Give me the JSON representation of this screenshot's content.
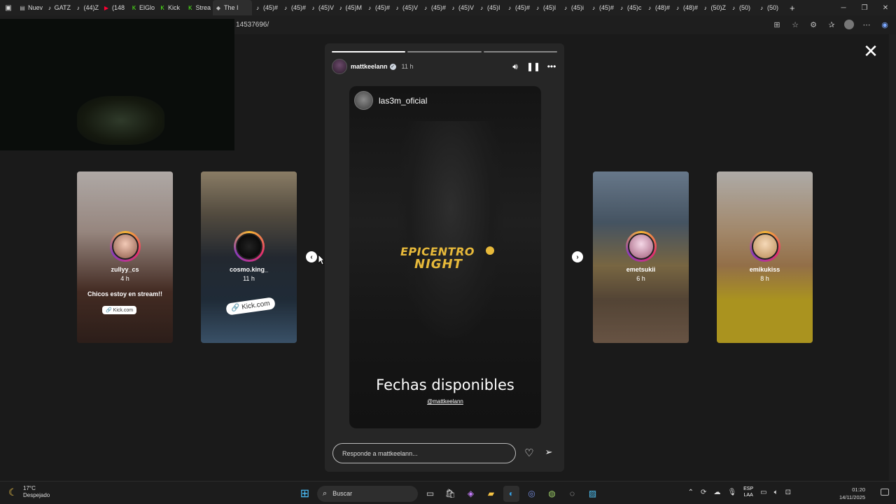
{
  "browser": {
    "tabs": [
      {
        "label": "Nuev",
        "icon": "document-icon",
        "color": "#bbbbbb"
      },
      {
        "label": "GATZ",
        "icon": "tiktok-icon",
        "color": "#ffffff"
      },
      {
        "label": "(44)Z",
        "icon": "tiktok-icon",
        "color": "#ffffff"
      },
      {
        "label": "(148",
        "icon": "youtube-icon",
        "color": "#ff0033"
      },
      {
        "label": "ElGlo",
        "icon": "kick-icon",
        "color": "#53fc18"
      },
      {
        "label": "Kick",
        "icon": "kick-icon",
        "color": "#53fc18"
      },
      {
        "label": "Strea",
        "icon": "kick-icon",
        "color": "#53fc18"
      },
      {
        "label": "The I",
        "icon": "diamond-icon",
        "color": "#bbbbbb"
      },
      {
        "label": "(45)#",
        "icon": "tiktok-icon",
        "color": "#ffffff"
      },
      {
        "label": "(45)#",
        "icon": "tiktok-icon",
        "color": "#ffffff"
      },
      {
        "label": "(45)V",
        "icon": "tiktok-icon",
        "color": "#ffffff"
      },
      {
        "label": "(45)M",
        "icon": "tiktok-icon",
        "color": "#ffffff"
      },
      {
        "label": "(45)#",
        "icon": "tiktok-icon",
        "color": "#ffffff"
      },
      {
        "label": "(45)V",
        "icon": "tiktok-icon",
        "color": "#ffffff"
      },
      {
        "label": "(45)#",
        "icon": "tiktok-icon",
        "color": "#ffffff"
      },
      {
        "label": "(45)V",
        "icon": "tiktok-icon",
        "color": "#ffffff"
      },
      {
        "label": "(45)I",
        "icon": "tiktok-icon",
        "color": "#ffffff"
      },
      {
        "label": "(45)#",
        "icon": "tiktok-icon",
        "color": "#ffffff"
      },
      {
        "label": "(45)l",
        "icon": "tiktok-icon",
        "color": "#ffffff"
      },
      {
        "label": "(45)i",
        "icon": "tiktok-icon",
        "color": "#ffffff"
      },
      {
        "label": "(45)#",
        "icon": "tiktok-icon",
        "color": "#ffffff"
      },
      {
        "label": "(45)c",
        "icon": "tiktok-icon",
        "color": "#ffffff"
      },
      {
        "label": "(48)#",
        "icon": "tiktok-icon",
        "color": "#ffffff"
      },
      {
        "label": "(48)#",
        "icon": "tiktok-icon",
        "color": "#ffffff"
      },
      {
        "label": "(50)Z",
        "icon": "tiktok-icon",
        "color": "#ffffff"
      },
      {
        "label": "(50)",
        "icon": "tiktok-icon",
        "color": "#ffffff"
      },
      {
        "label": "(50)",
        "icon": "tiktok-icon",
        "color": "#ffffff"
      }
    ],
    "url": "14537696/"
  },
  "story": {
    "username": "mattkeelann",
    "time": "11 h",
    "media_user": "las3m_oficial",
    "logo_line1": "EPICENTRO",
    "logo_line2": "NIGHT",
    "caption": "Fechas disponibles",
    "mention": "@mattkeelann",
    "reply_placeholder": "Responde a mattkeelann...",
    "progress": [
      1,
      0,
      0
    ]
  },
  "cards": [
    {
      "username": "zullyy_cs",
      "time": "4 h",
      "text": "Chicos estoy en stream!!",
      "badge": "Kick.com"
    },
    {
      "username": "cosmo.king_",
      "time": "11 h",
      "text": "",
      "badge": "Kick.com"
    },
    {
      "username": "emetsukii",
      "time": "6 h",
      "text": "",
      "badge": ""
    },
    {
      "username": "emikukiss",
      "time": "8 h",
      "text": "",
      "badge": ""
    }
  ],
  "taskbar": {
    "temperature": "17°C",
    "weather": "Despejado",
    "search": "Buscar",
    "lang1": "ESP",
    "lang2": "LAA",
    "time": "01:20",
    "date": "14/11/2025"
  }
}
